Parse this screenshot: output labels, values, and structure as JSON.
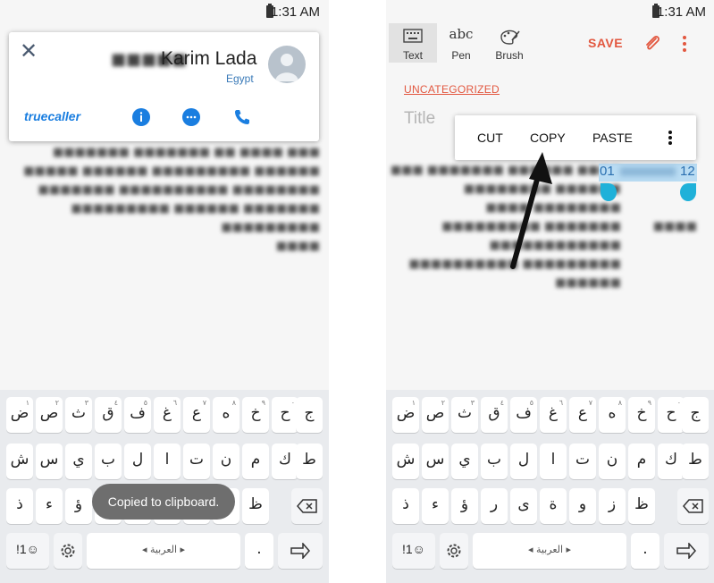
{
  "status_bar": {
    "time": "1:31 AM"
  },
  "left": {
    "truecaller": {
      "name": "Karim Lada",
      "country": "Egypt",
      "logo_text": "truecaller"
    },
    "toast": "Copied to clipboard."
  },
  "right": {
    "toolbar": {
      "tools": [
        {
          "label": "Text",
          "icon": "keyboard-icon"
        },
        {
          "label": "Pen",
          "icon": "abc-pen-icon"
        },
        {
          "label": "Brush",
          "icon": "palette-icon"
        }
      ],
      "pen_glyph": "abc",
      "save": "SAVE"
    },
    "category": "UNCATEGORIZED",
    "title_placeholder": "Title",
    "context_menu": {
      "cut": "CUT",
      "copy": "COPY",
      "paste": "PASTE"
    },
    "selection": {
      "start": "01",
      "end": "12"
    }
  },
  "keyboard": {
    "row1": [
      {
        "ch": "ض",
        "sub": "١"
      },
      {
        "ch": "ص",
        "sub": "٢"
      },
      {
        "ch": "ث",
        "sub": "٣"
      },
      {
        "ch": "ق",
        "sub": "٤"
      },
      {
        "ch": "ف",
        "sub": "٥"
      },
      {
        "ch": "غ",
        "sub": "٦"
      },
      {
        "ch": "ع",
        "sub": "٧"
      },
      {
        "ch": "ه",
        "sub": "٨"
      },
      {
        "ch": "خ",
        "sub": "٩"
      },
      {
        "ch": "ح",
        "sub": "٠"
      },
      {
        "ch": "ج",
        "sub": ""
      }
    ],
    "row2": [
      "ش",
      "س",
      "ي",
      "ب",
      "ل",
      "ا",
      "ت",
      "ن",
      "م",
      "ك",
      "ط"
    ],
    "row3": [
      "ذ",
      "ء",
      "ؤ",
      "ر",
      "ى",
      "ة",
      "و",
      "ز",
      "ظ"
    ],
    "symbols_key": "!1☺",
    "space_label": "◂ العربية ▸",
    "period_key": "."
  },
  "colors": {
    "accent": "#e2573f",
    "truecaller_blue": "#1a7ee0",
    "selection": "#b9dcf3",
    "handle": "#1fb1d9",
    "keyboard_bg": "#e9ebee"
  }
}
